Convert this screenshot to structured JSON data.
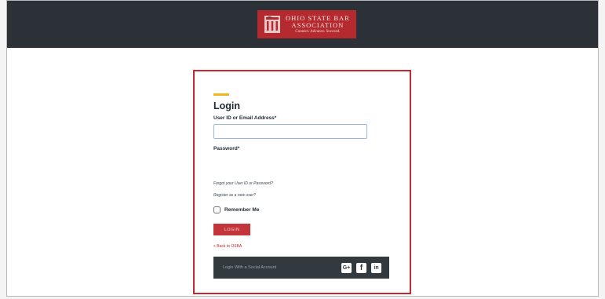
{
  "header": {
    "logo": {
      "line1": "OHIO STATE BAR",
      "line2": "ASSOCIATION",
      "line3": "Connect. Advance. Succeed."
    }
  },
  "login": {
    "title": "Login",
    "user_label": "User ID or Email Address*",
    "user_value": "",
    "password_label": "Password*",
    "forgot_link": "Forgot your User ID or Password?",
    "register_link": "Register as a new user?",
    "remember_label": "Remember Me",
    "login_button": "LOGIN",
    "back_link": "< Back to OSBA",
    "social_text": "Login With a Social Account",
    "social_icons": [
      {
        "name": "google-plus-icon",
        "glyph": "G+"
      },
      {
        "name": "facebook-icon",
        "glyph": "f"
      },
      {
        "name": "linkedin-icon",
        "glyph": "in"
      }
    ]
  },
  "colors": {
    "header_bg": "#2b3136",
    "logo_bg": "#b52a2e",
    "card_border": "#c7282d",
    "accent": "#f0b521",
    "button": "#c3343b",
    "social_bar": "#323a40"
  }
}
